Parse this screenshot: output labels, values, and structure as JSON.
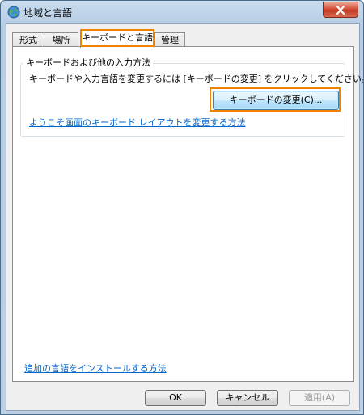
{
  "window": {
    "title": "地域と言語"
  },
  "tabs": [
    {
      "label": "形式"
    },
    {
      "label": "場所"
    },
    {
      "label": "キーボードと言語",
      "active": true
    },
    {
      "label": "管理"
    }
  ],
  "keyboard_group": {
    "title": "キーボードおよび他の入力方法",
    "description": "キーボードや入力言語を変更するには [キーボードの変更] をクリックしてください。",
    "change_button": "キーボードの変更(C)...",
    "welcome_link": "ようこそ画面のキーボード レイアウトを変更する方法"
  },
  "install_link": "追加の言語をインストールする方法",
  "footer": {
    "ok": "OK",
    "cancel": "キャンセル",
    "apply": "適用(A)"
  },
  "colors": {
    "highlight": "#f08300",
    "link": "#0066cc"
  },
  "icons": {
    "title": "globe-icon",
    "close": "close-icon"
  }
}
